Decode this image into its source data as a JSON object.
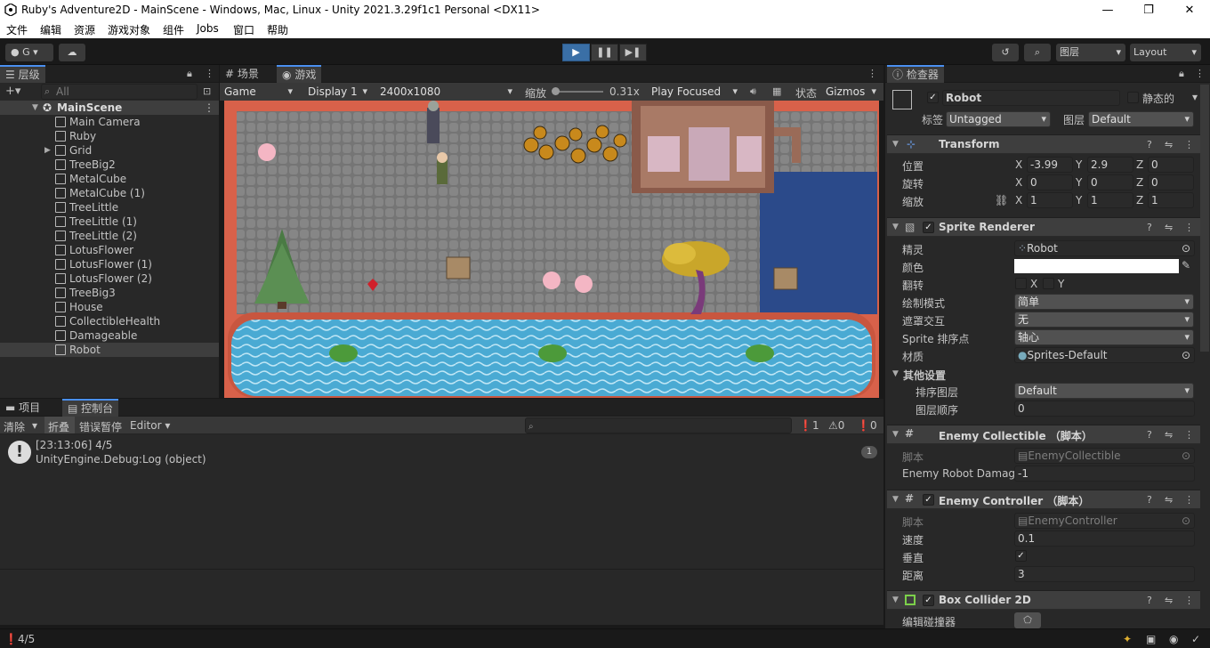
{
  "window": {
    "title": "Ruby's Adventure2D - MainScene - Windows, Mac, Linux - Unity 2021.3.29f1c1 Personal <DX11>",
    "minimize": "—",
    "maximize": "❐",
    "close": "✕"
  },
  "menu": [
    "文件",
    "编辑",
    "资源",
    "游戏对象",
    "组件",
    "Jobs",
    "窗口",
    "帮助"
  ],
  "toolbar": {
    "account": "G",
    "layers": "图层",
    "layout": "Layout"
  },
  "hierarchy": {
    "tab": "层级",
    "search_placeholder": "All",
    "scene": "MainScene",
    "items": [
      "Main Camera",
      "Ruby",
      "Grid",
      "TreeBig2",
      "MetalCube",
      "MetalCube (1)",
      "TreeLittle",
      "TreeLittle (1)",
      "TreeLittle (2)",
      "LotusFlower",
      "LotusFlower (1)",
      "LotusFlower (2)",
      "TreeBig3",
      "House",
      "CollectibleHealth",
      "Damageable",
      "Robot"
    ],
    "selected": "Robot"
  },
  "scene_tabs": {
    "scene": "场景",
    "game": "游戏"
  },
  "game_toolbar": {
    "display_mode": "Game",
    "display": "Display 1",
    "resolution": "2400x1080",
    "scale_label": "缩放",
    "scale_value": "0.31x",
    "play_mode": "Play Focused",
    "stats": "状态",
    "gizmos": "Gizmos"
  },
  "bottom_tabs": {
    "project": "项目",
    "console": "控制台"
  },
  "console": {
    "clear": "清除",
    "collapse": "折叠",
    "error_pause": "错误暂停",
    "editor": "Editor",
    "count_info": "1",
    "count_warn": "0",
    "count_error": "0",
    "entry_line1": "[23:13:06] 4/5",
    "entry_line2": "UnityEngine.Debug:Log (object)",
    "entry_count": "1"
  },
  "status_bar": {
    "message": "4/5"
  },
  "inspector": {
    "tab": "检查器",
    "object_name": "Robot",
    "static_label": "静态的",
    "tag_label": "标签",
    "tag_value": "Untagged",
    "layer_label": "图层",
    "layer_value": "Default",
    "transform": {
      "title": "Transform",
      "position_label": "位置",
      "rotation_label": "旋转",
      "scale_label": "缩放",
      "position": {
        "x": "-3.99",
        "y": "2.9",
        "z": "0"
      },
      "rotation": {
        "x": "0",
        "y": "0",
        "z": "0"
      },
      "scale": {
        "x": "1",
        "y": "1",
        "z": "1"
      }
    },
    "sprite_renderer": {
      "title": "Sprite Renderer",
      "sprite_label": "精灵",
      "sprite_value": "Robot",
      "color_label": "颜色",
      "flip_label": "翻转",
      "flip_x": "X",
      "flip_y": "Y",
      "draw_mode_label": "绘制模式",
      "draw_mode_value": "简单",
      "mask_label": "遮罩交互",
      "mask_value": "无",
      "sort_point_label": "Sprite 排序点",
      "sort_point_value": "轴心",
      "material_label": "材质",
      "material_value": "Sprites-Default",
      "other_settings": "其他设置",
      "sorting_layer_label": "排序图层",
      "sorting_layer_value": "Default",
      "order_label": "图层顺序",
      "order_value": "0"
    },
    "enemy_collectible": {
      "title": "Enemy Collectible （脚本）",
      "script_label": "脚本",
      "script_value": "EnemyCollectible",
      "damage_label": "Enemy Robot Damag",
      "damage_value": "-1"
    },
    "enemy_controller": {
      "title": "Enemy Controller （脚本）",
      "script_label": "脚本",
      "script_value": "EnemyController",
      "speed_label": "速度",
      "speed_value": "0.1",
      "vertical_label": "垂直",
      "distance_label": "距离",
      "distance_value": "3"
    },
    "box_collider": {
      "title": "Box Collider 2D",
      "edit_label": "编辑碰撞器"
    }
  },
  "colors": {
    "accent": "#3a72b0",
    "selected_row": "#2c5d87",
    "water": "#3e9fc9",
    "wall": "#d8614a",
    "floor": "#7a7a7a",
    "pond_blue": "#2b4a8a"
  }
}
